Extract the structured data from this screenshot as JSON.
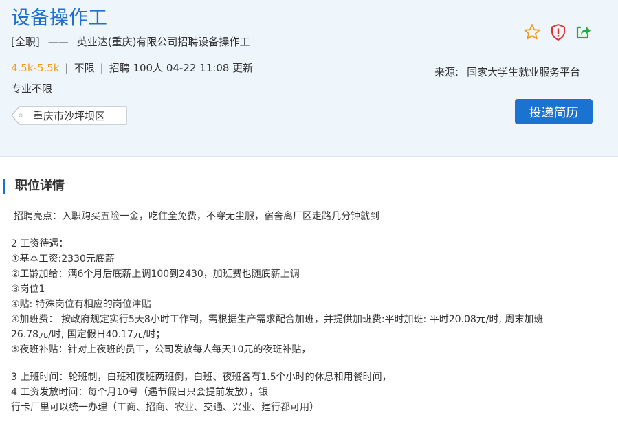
{
  "job": {
    "title": "设备操作工",
    "type": "[全职]",
    "dash": "——",
    "headline": "英业达(重庆)有限公司招聘设备操作工",
    "salary": "4.5k-5.5k",
    "sep": "|",
    "education": "不限",
    "recruit": "招聘 100人",
    "updated": "04-22 11:08 更新",
    "major": "专业不限",
    "location": "重庆市沙坪坝区"
  },
  "icons": {
    "favorite": "star-icon",
    "report": "shield-alert-icon",
    "share": "share-icon",
    "colors": {
      "star": "#f39b1a",
      "shield": "#e0302f",
      "share": "#2aa84a"
    }
  },
  "source": {
    "label": "来源:",
    "value": "国家大学生就业服务平台"
  },
  "actions": {
    "apply_label": "投递简历"
  },
  "section": {
    "heading": "职位详情"
  },
  "detail": {
    "highlight": "招聘亮点：入职购买五险一金，吃住全免费，不穿无尘服，宿舍离厂区走路几分钟就到",
    "wage_lines": [
      "2 工资待遇：",
      "①基本工资:2330元底薪",
      "②工龄加给：满6个月后底薪上调100到2430，加班费也随底薪上调",
      "③岗位1",
      "④贴: 特殊岗位有相应的岗位津贴",
      "④加班费： 按政府规定实行5天8小时工作制，需根据生产需求配合加班，并提供加班费:平时加班: 平时20.08元/时, 周末加班",
      "26.78元/时, 国定假日40.17元/时；",
      "⑤夜班补贴：针对上夜班的员工，公司发放每人每天10元的夜班补贴，"
    ],
    "other_lines": [
      "3 上班时间：轮班制，白班和夜班两班倒，白班、夜班各有1.5个小时的休息和用餐时间，",
      "4 工资发放时间：每个月10号（遇节假日只会提前发放），银",
      "行卡厂里可以统一办理（工商、招商、农业、交通、兴业、建行都可用）"
    ]
  },
  "colors": {
    "accent": "#1a73d1",
    "title": "#1f6fd0",
    "salary": "#f39b1a",
    "header_bg": "#eef5fb"
  }
}
